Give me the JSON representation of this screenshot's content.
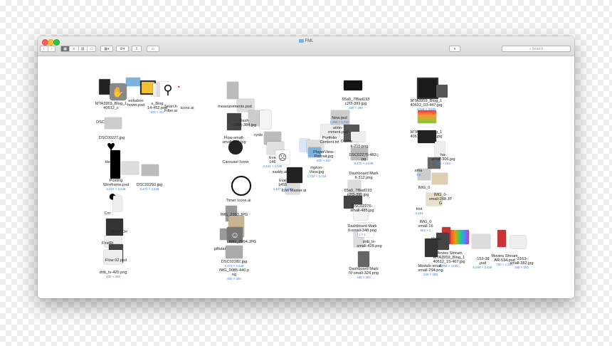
{
  "window": {
    "title": "FML",
    "nav_back": "‹",
    "nav_forward": "›",
    "search_placeholder": "Search",
    "dropbox_label": "▾"
  },
  "files": [
    {
      "id": "f1",
      "label": "MTA3959_Blog_1\n40612_c",
      "size": ""
    },
    {
      "id": "f2",
      "label": "eekaboo\nhover.psd",
      "size": ""
    },
    {
      "id": "f3",
      "label": "s_Blog\n14-452.psd",
      "size": "320 × 407"
    },
    {
      "id": "f4",
      "label": "Search\nFilter.ai",
      "size": ""
    },
    {
      "id": "f5",
      "label": "icons.ai",
      "size": ""
    },
    {
      "id": "f6",
      "label": "DSC",
      "size": ""
    },
    {
      "id": "f7",
      "label": "DSC00227.jpg",
      "size": ""
    },
    {
      "id": "f8",
      "label": "He",
      "size": ""
    },
    {
      "id": "f9",
      "label": "Posting\nWireframe.psd",
      "size": "5,472 × 3,648"
    },
    {
      "id": "f10",
      "label": "DSC02293.jpg",
      "size": "5,472 × 3,648"
    },
    {
      "id": "f11",
      "label": "Cor",
      "size": ""
    },
    {
      "id": "f12",
      "label": "SWATCH",
      "size": ""
    },
    {
      "id": "f13",
      "label": "FirstRi",
      "size": ""
    },
    {
      "id": "f14",
      "label": "Flow 02.psd",
      "size": ""
    },
    {
      "id": "f15",
      "label": "drib_tx-425.png",
      "size": "400 × 300"
    },
    {
      "id": "f16",
      "label": "measurements.psd",
      "size": ""
    },
    {
      "id": "f17",
      "label": "Dash\n-3386-384.jpg",
      "size": ""
    },
    {
      "id": "f18",
      "label": "Flow-small-\nsmall-285.jpg",
      "size": ""
    },
    {
      "id": "f19",
      "label": "cycle",
      "size": ""
    },
    {
      "id": "f20",
      "label": "Carousel Icons",
      "size": ""
    },
    {
      "id": "f21",
      "label": "Timer Icons.ai",
      "size": ""
    },
    {
      "id": "f22",
      "label": "IMG_2993.JPG",
      "size": ""
    },
    {
      "id": "f23",
      "label": "IMG_2994.JPG",
      "size": ""
    },
    {
      "id": "f24",
      "label": "giftstar",
      "size": ""
    },
    {
      "id": "f25",
      "label": "DSC02282.jpg",
      "size": "5,472 × 3,648"
    },
    {
      "id": "f26",
      "label": "IMG_0085-440.p\nng",
      "size": "400 × 300"
    },
    {
      "id": "f27",
      "label": "Eve\n146",
      "size": "4,344 × 3,048"
    },
    {
      "id": "f28",
      "label": "saddy.ai",
      "size": ""
    },
    {
      "id": "f29",
      "label": "Eve\n1455",
      "size": "2,447 × 3,200"
    },
    {
      "id": "f30",
      "label": "Icon Master.ai",
      "size": ""
    },
    {
      "id": "f31",
      "label": "Portfolio\nContent.txt",
      "size": ""
    },
    {
      "id": "f32",
      "label": "ation-\nrnment.psd",
      "size": ""
    },
    {
      "id": "f33",
      "label": "PlayerView-\nPortrait.jpg",
      "size": "600 × 607"
    },
    {
      "id": "f34",
      "label": "mpton-\nView.jpg",
      "size": "1,334 × 1,334"
    },
    {
      "id": "f35",
      "label": "65a0_7f8ad193\nc2f3-399.jpg",
      "size": "360 × 280"
    },
    {
      "id": "f36",
      "label": "New.psd",
      "size": "1,360 × 1,240"
    },
    {
      "id": "f37",
      "label": "Dashb",
      "size": ""
    },
    {
      "id": "f38",
      "label": "ti-215.png",
      "size": ""
    },
    {
      "id": "f39",
      "label": "DSC02276-483.j\npg",
      "size": "5,472 × 3,648"
    },
    {
      "id": "f40",
      "label": "Dashboard Mark\nII-312.png",
      "size": ""
    },
    {
      "id": "f41",
      "label": "65a0_7f8ad193\nc2f3-395.jpg",
      "size": ""
    },
    {
      "id": "f42",
      "label": "DSC02276-\nsmall-485.jpg",
      "size": ""
    },
    {
      "id": "f43",
      "label": "Dashboard Mark\nII-small-348.png",
      "size": "1 × 1"
    },
    {
      "id": "f44",
      "label": "drib_tx-\nsmall-428.png",
      "size": ""
    },
    {
      "id": "f45",
      "label": "Dashboard Mark\nIV-small-324.png",
      "size": "166 × 266"
    },
    {
      "id": "f46",
      "label": "MTA3959_Blog_1\n40612_03-447.jpg",
      "size": "4,344 × 3,000"
    },
    {
      "id": "f47",
      "label": "MTA3959_Blog_1\n40612_03-453.jpg",
      "size": ""
    },
    {
      "id": "f48",
      "label": "ha-\nsmall-306.jpg",
      "size": "255 × 164"
    },
    {
      "id": "f49",
      "label": "sma",
      "size": "4,0"
    },
    {
      "id": "f50",
      "label": "IMG_0",
      "size": ""
    },
    {
      "id": "f51",
      "label": "IMG_0-\nsmall-288.JP\nG",
      "size": ""
    },
    {
      "id": "f52",
      "label": "Hot",
      "size": "5,264"
    },
    {
      "id": "f53",
      "label": "IMG_0\nsmall-16",
      "size": "902 × 1"
    },
    {
      "id": "f54",
      "label": "Moda",
      "size": ""
    },
    {
      "id": "f55",
      "label": "Movies Stream\nMTA3959_Blog_1\n40612_15-467.jpg",
      "size": "6,000 × 4,000"
    },
    {
      "id": "f56",
      "label": "-153-38\n.psd",
      "size": "5,264 × 2,448"
    },
    {
      "id": "f57",
      "label": "Movies Stream\nAR-534.psd",
      "size": "750 × 1,334"
    },
    {
      "id": "f58",
      "label": "-3163-\nsmall-382.jpg",
      "size": "258 × 192"
    },
    {
      "id": "f59",
      "label": "Modals-small-\nsmall-294.png",
      "size": "348 × 298"
    }
  ],
  "icons": [
    "back-arrow-icon",
    "forward-arrow-icon",
    "icon-view-icon",
    "list-view-icon",
    "column-view-icon",
    "coverflow-view-icon",
    "arrange-icon",
    "gear-icon",
    "share-icon",
    "tag-icon",
    "dropbox-icon",
    "search-icon",
    "folder-icon",
    "hand-icon",
    "magnifier-icon",
    "heart-icon",
    "speech-bubble-icon",
    "timer-icon"
  ]
}
